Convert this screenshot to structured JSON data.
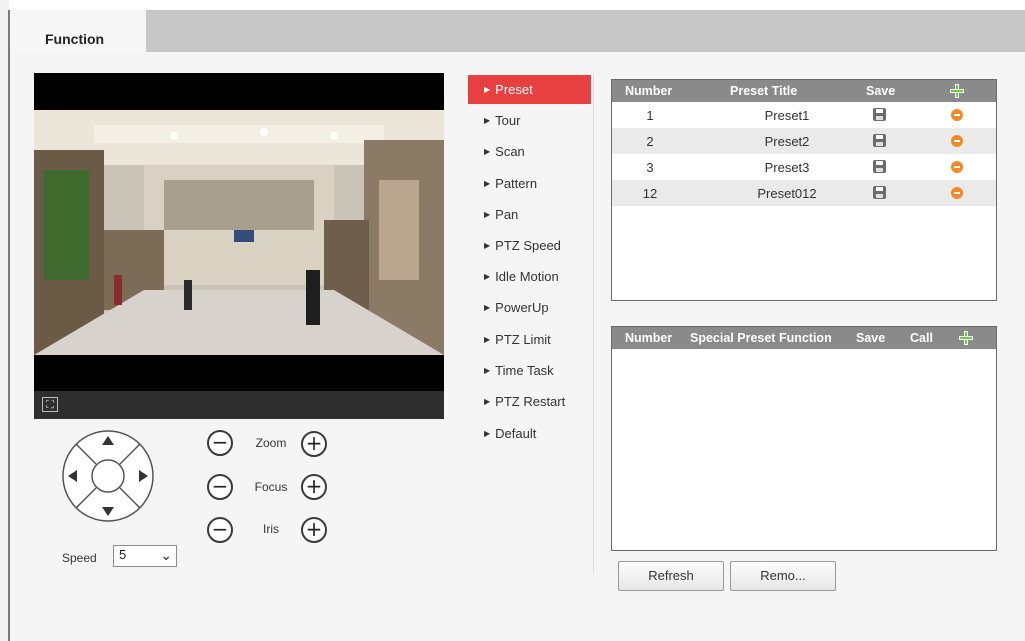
{
  "tab": {
    "label": "Function"
  },
  "video": {
    "fullscreen_icon": "fullscreen-icon"
  },
  "ptz": {
    "speed_label": "Speed",
    "speed_value": "5",
    "zoom_label": "Zoom",
    "focus_label": "Focus",
    "iris_label": "Iris",
    "minus": "−",
    "plus": "+"
  },
  "menu": {
    "items": [
      {
        "label": "Preset"
      },
      {
        "label": "Tour"
      },
      {
        "label": "Scan"
      },
      {
        "label": "Pattern"
      },
      {
        "label": "Pan"
      },
      {
        "label": "PTZ Speed"
      },
      {
        "label": "Idle Motion"
      },
      {
        "label": "PowerUp"
      },
      {
        "label": "PTZ Limit"
      },
      {
        "label": "Time Task"
      },
      {
        "label": "PTZ Restart"
      },
      {
        "label": "Default"
      }
    ],
    "active": "Preset"
  },
  "preset_table": {
    "headers": {
      "number": "Number",
      "title": "Preset Title",
      "save": "Save"
    },
    "rows": [
      {
        "number": "1",
        "title": "Preset1"
      },
      {
        "number": "2",
        "title": "Preset2"
      },
      {
        "number": "3",
        "title": "Preset3"
      },
      {
        "number": "12",
        "title": "Preset012"
      }
    ]
  },
  "special_table": {
    "headers": {
      "number": "Number",
      "function": "Special Preset Function",
      "save": "Save",
      "call": "Call"
    }
  },
  "buttons": {
    "refresh": "Refresh",
    "remove": "Remo..."
  },
  "colors": {
    "accent": "#e84040",
    "header_bg": "#8a8a8a",
    "add": "#6bcf3b",
    "delete": "#f08a24"
  }
}
